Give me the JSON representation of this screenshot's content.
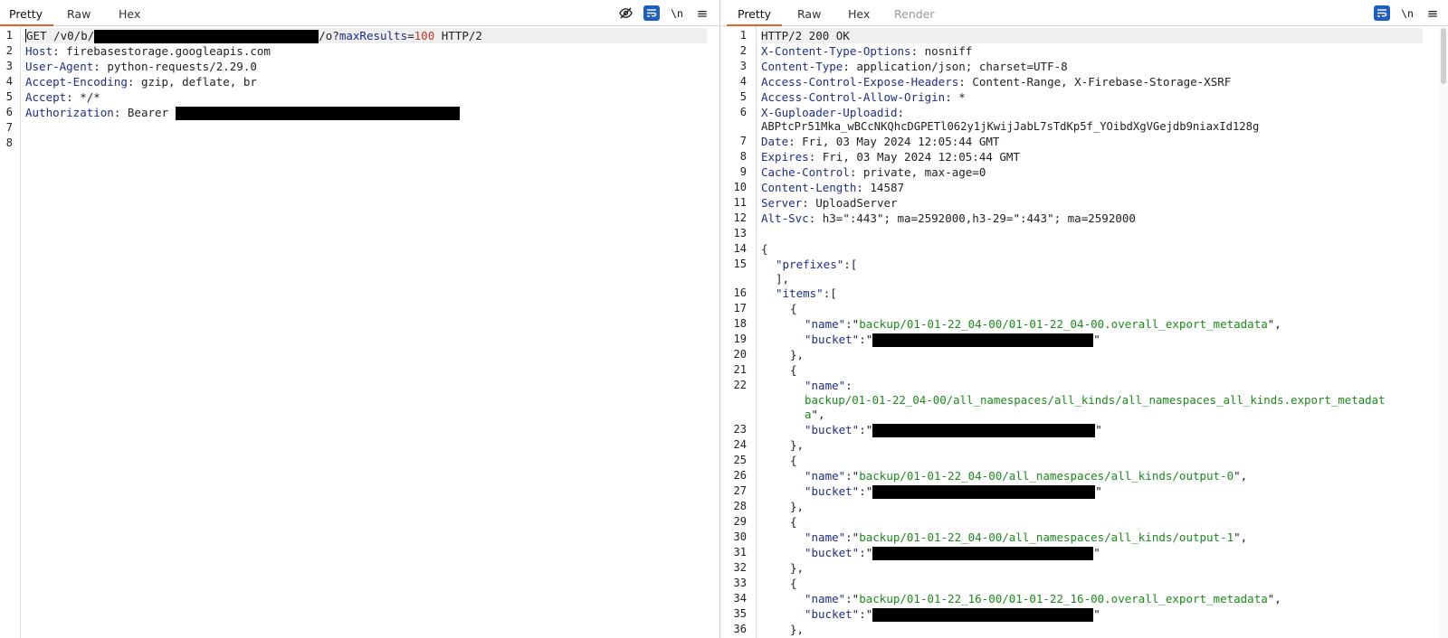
{
  "request": {
    "tabs": [
      "Pretty",
      "Raw",
      "Hex"
    ],
    "active_tab": "Pretty",
    "tools": {
      "newline_label": "\\n",
      "menu_glyph": "≡"
    },
    "line_numbers": [
      "1",
      "2",
      "3",
      "4",
      "5",
      "6",
      "7",
      "8"
    ],
    "lines": {
      "l1_method": "GET /v0/b/",
      "l1_mid": "/o?",
      "l1_param": "maxResults",
      "l1_eq": "=",
      "l1_value": "100",
      "l1_proto": " HTTP/2",
      "l2_key": "Host",
      "l2_val": ": firebasestorage.googleapis.com",
      "l3_key": "User-Agent",
      "l3_val": ": python-requests/2.29.0",
      "l4_key": "Accept-Encoding",
      "l4_val": ": gzip, deflate, br",
      "l5_key": "Accept",
      "l5_val": ": */*",
      "l6_key": "Authorization",
      "l6_val": ": Bearer "
    }
  },
  "response": {
    "tabs": [
      "Pretty",
      "Raw",
      "Hex",
      "Render"
    ],
    "active_tab": "Pretty",
    "disabled_tab": "Render",
    "tools": {
      "newline_label": "\\n",
      "menu_glyph": "≡"
    },
    "line_numbers": [
      "1",
      "2",
      "3",
      "4",
      "5",
      "6",
      "7",
      "8",
      "9",
      "10",
      "11",
      "12",
      "13",
      "14",
      "15",
      "16",
      "17",
      "18",
      "19",
      "20",
      "21",
      "22",
      "23",
      "24",
      "25",
      "26",
      "27",
      "28",
      "29",
      "30",
      "31",
      "32",
      "33",
      "34",
      "35",
      "36"
    ],
    "status": "HTTP/2 200 OK",
    "headers": [
      {
        "k": "X-Content-Type-Options",
        "v": ": nosniff"
      },
      {
        "k": "Content-Type",
        "v": ": application/json; charset=UTF-8"
      },
      {
        "k": "Access-Control-Expose-Headers",
        "v": ": Content-Range, X-Firebase-Storage-XSRF"
      },
      {
        "k": "Access-Control-Allow-Origin",
        "v": ": *"
      },
      {
        "k": "X-Guploader-Uploadid",
        "v": ":"
      },
      {
        "k": "Date",
        "v": ": Fri, 03 May 2024 12:05:44 GMT"
      },
      {
        "k": "Expires",
        "v": ": Fri, 03 May 2024 12:05:44 GMT"
      },
      {
        "k": "Cache-Control",
        "v": ": private, max-age=0"
      },
      {
        "k": "Content-Length",
        "v": ": 14587"
      },
      {
        "k": "Server",
        "v": ": UploadServer"
      },
      {
        "k": "Alt-Svc",
        "v": ": h3=\":443\"; ma=2592000,h3-29=\":443\"; ma=2592000"
      }
    ],
    "upload_id_value": "ABPtcPr51Mka_wBCcNKQhcDGPETl062y1jKwijJabL7sTdKp5f_YOibdXgVGejdb9niaxId128g",
    "json": {
      "open_brace": "{",
      "prefixes_key": "\"prefixes\"",
      "prefixes_open": ":[",
      "prefixes_close": "],",
      "items_key": "\"items\"",
      "items_open": ":[",
      "obj_open": "{",
      "obj_close": "},",
      "name_key": "\"name\"",
      "bucket_key": "\"bucket\"",
      "colon_quote": ":\"",
      "colon": ":",
      "quote": "\"",
      "quote_comma": "\",",
      "item1_name": "backup/01-01-22_04-00/01-01-22_04-00.overall_export_metadata",
      "item2_name_a": "backup/01-01-22_04-00/all_namespaces/all_kinds/all_namespaces_all_kinds.export_metadat",
      "item2_name_b": "a",
      "item3_name": "backup/01-01-22_04-00/all_namespaces/all_kinds/output-0",
      "item4_name": "backup/01-01-22_04-00/all_namespaces/all_kinds/output-1",
      "item5_name": "backup/01-01-22_16-00/01-01-22_16-00.overall_export_metadata"
    }
  }
}
